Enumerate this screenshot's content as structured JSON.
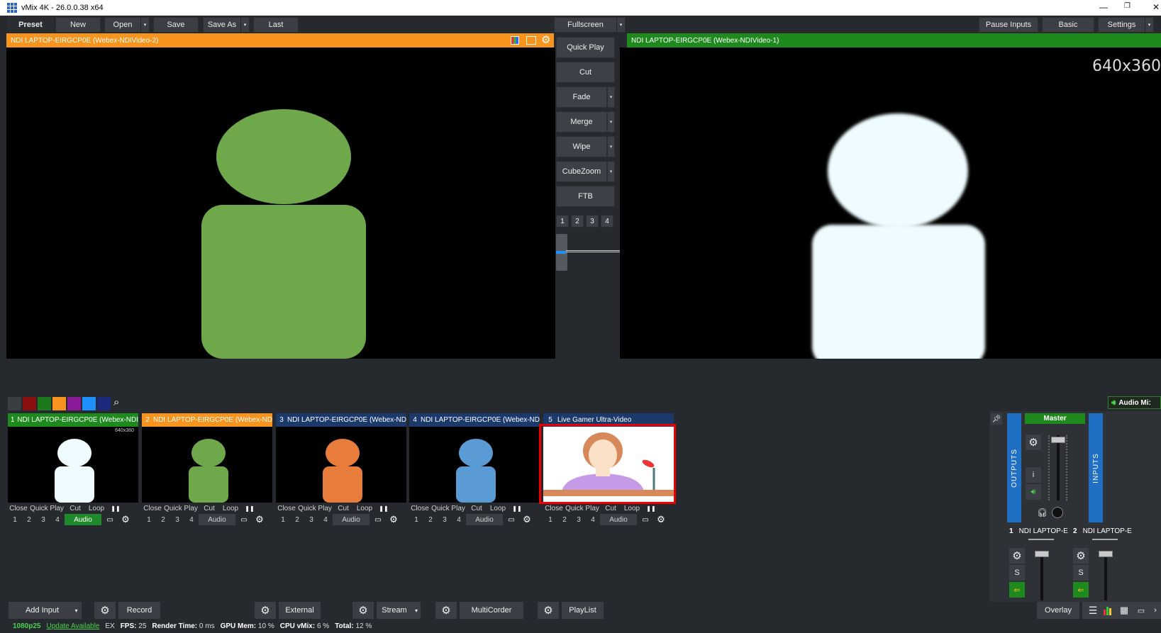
{
  "window": {
    "title": "vMix 4K - 26.0.0.38 x64",
    "minimize": "—",
    "restore": "❐",
    "close": "✕"
  },
  "toolbar": {
    "preset": "Preset",
    "new": "New",
    "open": "Open",
    "save": "Save",
    "save_as": "Save As",
    "last": "Last",
    "fullscreen": "Fullscreen",
    "pause_inputs": "Pause Inputs",
    "basic": "Basic",
    "settings": "Settings"
  },
  "preview": {
    "title": "NDI LAPTOP-EIRGCP0E (Webex-NDIVideo-2)",
    "color": "#f7941d"
  },
  "output": {
    "title": "NDI LAPTOP-EIRGCP0E (Webex-NDIVideo-1)",
    "resolution": "640x360",
    "color": "#1e8a1e"
  },
  "transitions": {
    "quick_play": "Quick Play",
    "cut": "Cut",
    "fade": "Fade",
    "merge": "Merge",
    "wipe": "Wipe",
    "cubezoom": "CubeZoom",
    "ftb": "FTB",
    "numbers": [
      "1",
      "2",
      "3",
      "4"
    ]
  },
  "filter_colors": [
    "#3a3d42",
    "#8b0f0f",
    "#1c7a1c",
    "#f7941d",
    "#8b1a9b",
    "#1e90ff",
    "#1b2a7a"
  ],
  "audio_mixer_label": "Audio Mi:",
  "inputs": [
    {
      "number": "1",
      "title": "NDI LAPTOP-EIRGCP0E (Webex-NDI",
      "head_color": "#1e8a1e",
      "figure_color": "#eefcff",
      "res": "640x360",
      "audio_on": true
    },
    {
      "number": "2",
      "title": "NDI LAPTOP-EIRGCP0E (Webex-ND",
      "head_color": "#f7941d",
      "figure_color": "#6fa84a",
      "res": "",
      "audio_on": false
    },
    {
      "number": "3",
      "title": "NDI LAPTOP-EIRGCP0E (Webex-ND",
      "head_color": "#1b3a6b",
      "figure_color": "#e87c3a",
      "res": "",
      "audio_on": false
    },
    {
      "number": "4",
      "title": "NDI LAPTOP-EIRGCP0E (Webex-ND",
      "head_color": "#1b3a6b",
      "figure_color": "#5b9bd5",
      "res": "",
      "audio_on": false
    },
    {
      "number": "5",
      "title": "Live Gamer Ultra-Video",
      "head_color": "#1b3a6b",
      "figure_color": "",
      "res": "",
      "audio_on": false
    }
  ],
  "card_controls": {
    "close": "Close",
    "quick_play": "Quick Play",
    "cut": "Cut",
    "loop": "Loop",
    "pause": "❚❚",
    "audio": "Audio",
    "nums": [
      "1",
      "2",
      "3",
      "4"
    ]
  },
  "mixer": {
    "outputs": "OUTPUTS",
    "inputs": "INPUTS",
    "master": "Master",
    "info": "i",
    "solo": "S",
    "ch1_num": "1",
    "ch1_name": "NDI LAPTOP-E",
    "ch2_num": "2",
    "ch2_name": "NDI LAPTOP-E"
  },
  "bottom": {
    "add_input": "Add Input",
    "record": "Record",
    "external": "External",
    "stream": "Stream",
    "multicorder": "MultiCorder",
    "playlist": "PlayList",
    "overlay": "Overlay"
  },
  "status": {
    "format": "1080p25",
    "update": "Update Available",
    "ex": "EX",
    "fps_label": "FPS:",
    "fps": "25",
    "render_label": "Render Time:",
    "render": "0 ms",
    "gpu_label": "GPU Mem:",
    "gpu": "10 %",
    "cpu_label": "CPU vMix:",
    "cpu": "6 %",
    "total_label": "Total:",
    "total": "12 %"
  }
}
